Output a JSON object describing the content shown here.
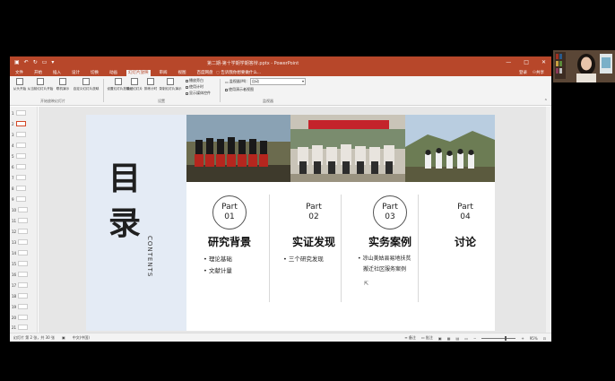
{
  "titlebar": {
    "document_title": "第二期-第十学期学期答辩.pptx - PowerPoint",
    "minimize": "—",
    "maximize": "□",
    "close": "✕"
  },
  "tabs": [
    "文件",
    "开始",
    "插入",
    "设计",
    "切换",
    "动画",
    "幻灯片放映",
    "审阅",
    "视图",
    "百度网盘"
  ],
  "active_tab_index": 6,
  "tell_me": "告诉我你想要做什么...",
  "account": {
    "sign_in": "登录",
    "share": "共享"
  },
  "ribbon": {
    "buttons": [
      {
        "label": "从头开始"
      },
      {
        "label": "从当前幻灯片开始"
      },
      {
        "label": "联机演示"
      },
      {
        "label": "自定义幻灯片放映"
      },
      {
        "label": "设置幻灯片放映"
      },
      {
        "label": "隐藏幻灯片"
      },
      {
        "label": "排练计时"
      },
      {
        "label": "录制幻灯片演示"
      }
    ],
    "groups": [
      "开始放映幻灯片",
      "设置",
      "监视器"
    ],
    "checkboxes": [
      "播放旁白",
      "使用计时",
      "显示媒体控件"
    ],
    "monitor_label": "监视器(M):",
    "monitor_value": "自动",
    "presenter_view": "使用演示者视图"
  },
  "thumbnails": [
    "1",
    "2",
    "3",
    "4",
    "5",
    "6",
    "7",
    "8",
    "9",
    "10",
    "11",
    "12",
    "13",
    "14",
    "15",
    "16",
    "17",
    "18",
    "19",
    "20",
    "21"
  ],
  "current_slide_index": 1,
  "slide": {
    "title_chars": [
      "目",
      "录"
    ],
    "contents_label": "CONTENTS",
    "parts": [
      {
        "word": "Part",
        "num": "01",
        "title": "研究背景",
        "bullets": [
          "理论基础",
          "文献计量"
        ]
      },
      {
        "word": "Part",
        "num": "02",
        "title": "实证发现",
        "bullets": [
          "三个研究发现"
        ]
      },
      {
        "word": "Part",
        "num": "03",
        "title": "实务案例",
        "bullets": [
          "凉山美姑县易地扶贫",
          "搬迁社区服务案例"
        ]
      },
      {
        "word": "Part",
        "num": "04",
        "title": "讨论",
        "bullets": []
      }
    ]
  },
  "statusbar": {
    "slide_info": "幻灯片 第 2 张，共 30 张",
    "language": "中文(中国)",
    "notes": "备注",
    "comments": "批注",
    "zoom": "95%"
  }
}
